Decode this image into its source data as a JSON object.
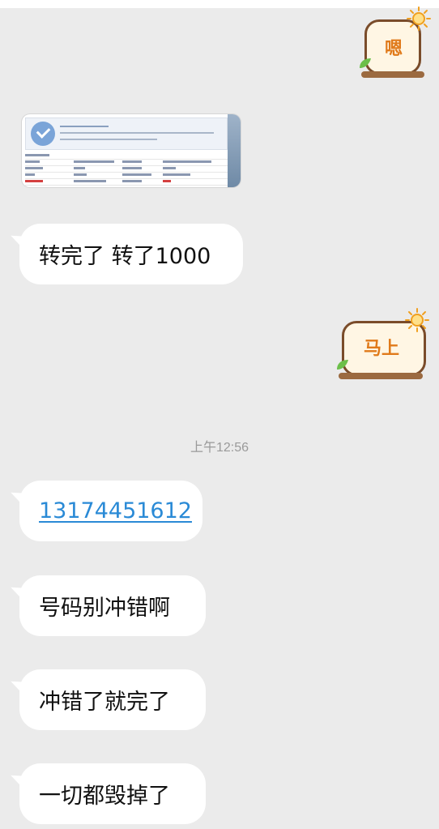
{
  "messages": {
    "sticker_1": {
      "text": "嗯"
    },
    "sticker_2": {
      "text": "马上"
    },
    "bubble_1": "转完了 转了1000",
    "timestamp": "上午12:56",
    "bubble_phone": "13174451612",
    "bubble_3": "号码别冲错啊",
    "bubble_4": "冲错了就完了",
    "bubble_5": "一切都毁掉了"
  },
  "colors": {
    "background": "#ebebeb",
    "bubble": "#ffffff",
    "link": "#2a8ad6",
    "sticker_text": "#e07a1a"
  }
}
